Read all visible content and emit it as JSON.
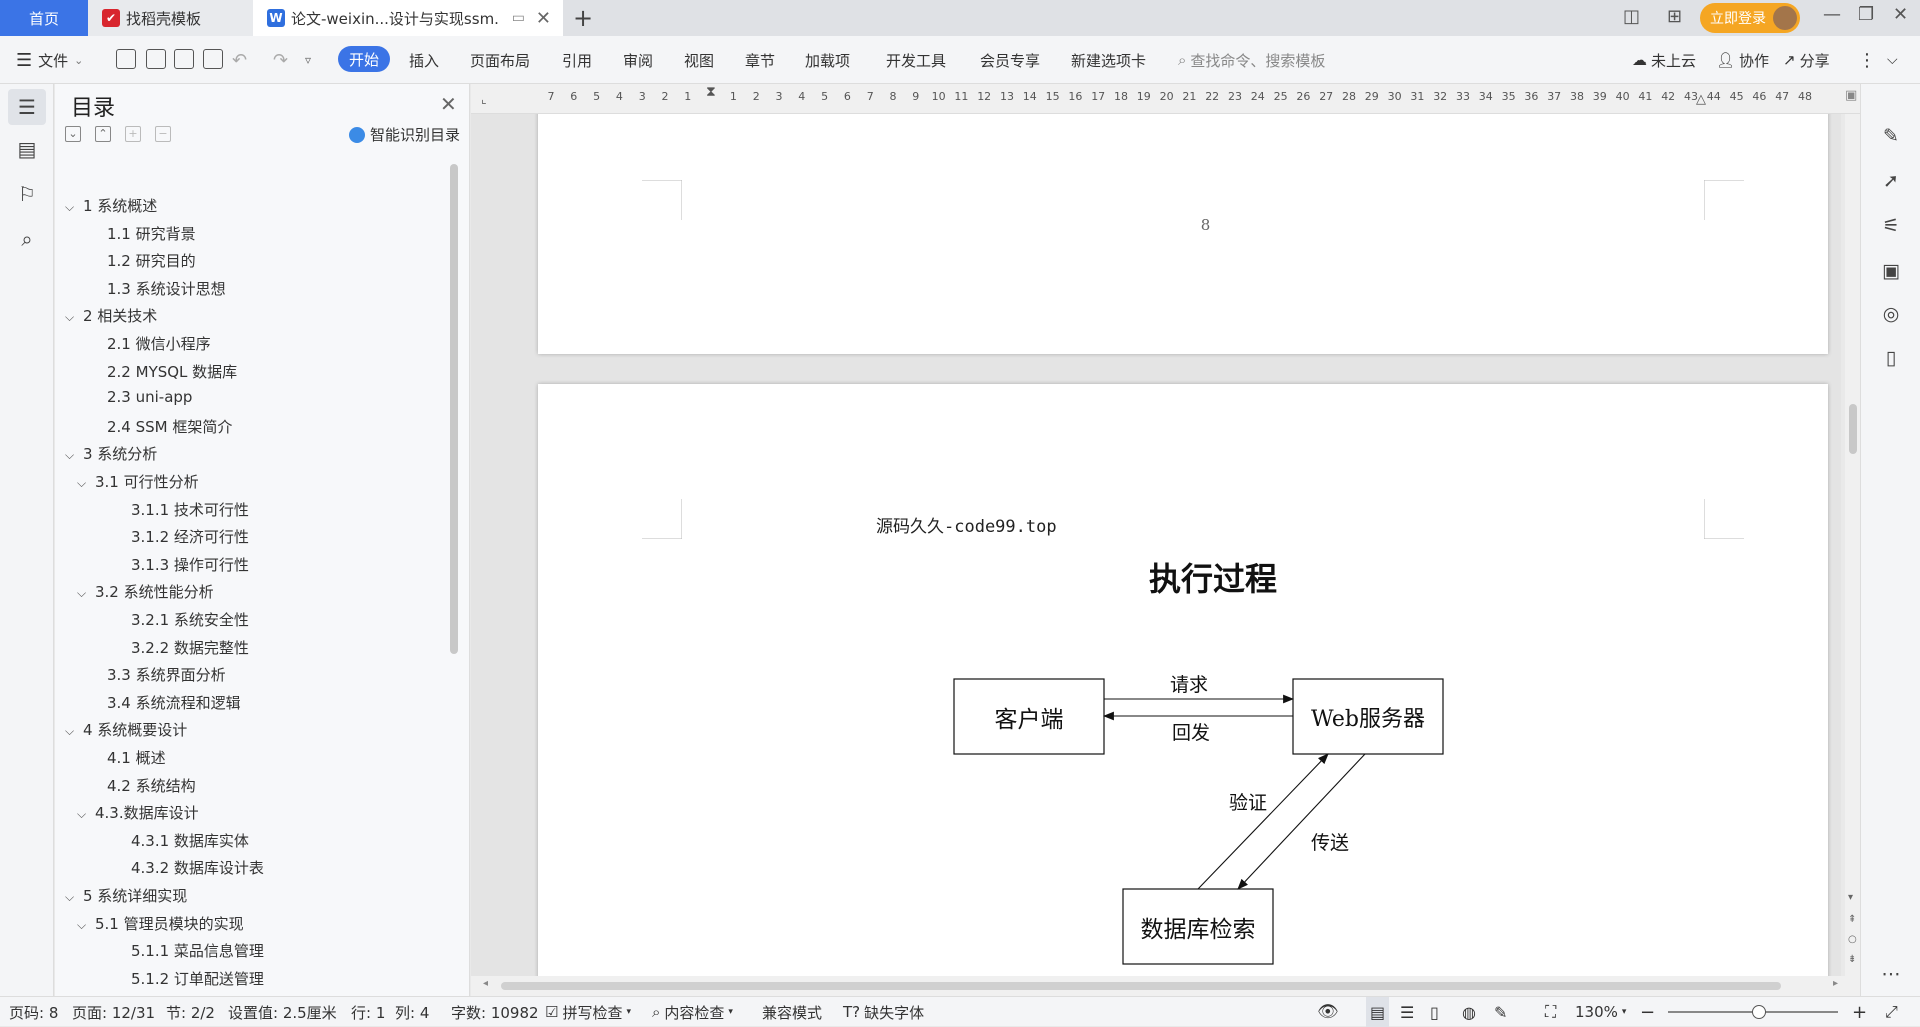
{
  "tabs": {
    "home": "首页",
    "template": "找稻壳模板",
    "document": "论文-weixin...设计与实现ssm."
  },
  "titlebar": {
    "login": "立即登录"
  },
  "toolbar": {
    "file": "文件",
    "tabs": [
      "开始",
      "插入",
      "页面布局",
      "引用",
      "审阅",
      "视图",
      "章节",
      "加载项",
      "开发工具",
      "会员专享",
      "新建选项卡"
    ],
    "search_placeholder": "查找命令、搜索模板",
    "cloud": "未上云",
    "collab": "协作",
    "share": "分享"
  },
  "toc": {
    "title": "目录",
    "smart": "智能识别目录",
    "items": [
      {
        "label": "1 系统概述",
        "level": 1,
        "arrow": true
      },
      {
        "label": "1.1  研究背景",
        "level": 2,
        "arrow": false
      },
      {
        "label": "1.2 研究目的",
        "level": 2,
        "arrow": false
      },
      {
        "label": "1.3 系统设计思想",
        "level": 2,
        "arrow": false
      },
      {
        "label": "2 相关技术",
        "level": 1,
        "arrow": true
      },
      {
        "label": "2.1 微信小程序",
        "level": 2,
        "arrow": false
      },
      {
        "label": "2.2 MYSQL 数据库",
        "level": 2,
        "arrow": false
      },
      {
        "label": "2.3 uni-app",
        "level": 2,
        "arrow": false
      },
      {
        "label": "2.4 SSM 框架简介",
        "level": 2,
        "arrow": false
      },
      {
        "label": "3 系统分析",
        "level": 1,
        "arrow": true
      },
      {
        "label": "3.1 可行性分析",
        "level": 2,
        "arrow": true
      },
      {
        "label": "3.1.1 技术可行性",
        "level": 3,
        "arrow": false
      },
      {
        "label": "3.1.2 经济可行性",
        "level": 3,
        "arrow": false
      },
      {
        "label": "3.1.3 操作可行性",
        "level": 3,
        "arrow": false
      },
      {
        "label": "3.2 系统性能分析",
        "level": 2,
        "arrow": true
      },
      {
        "label": "3.2.1  系统安全性",
        "level": 3,
        "arrow": false
      },
      {
        "label": "3.2.2  数据完整性",
        "level": 3,
        "arrow": false
      },
      {
        "label": "3.3 系统界面分析",
        "level": 2,
        "arrow": false
      },
      {
        "label": "3.4 系统流程和逻辑",
        "level": 2,
        "arrow": false
      },
      {
        "label": "4 系统概要设计",
        "level": 1,
        "arrow": true
      },
      {
        "label": "4.1 概述",
        "level": 2,
        "arrow": false
      },
      {
        "label": "4.2 系统结构",
        "level": 2,
        "arrow": false
      },
      {
        "label": "4.3.数据库设计",
        "level": 2,
        "arrow": true
      },
      {
        "label": "4.3.1 数据库实体",
        "level": 3,
        "arrow": false
      },
      {
        "label": "4.3.2 数据库设计表",
        "level": 3,
        "arrow": false
      },
      {
        "label": "5 系统详细实现",
        "level": 1,
        "arrow": true
      },
      {
        "label": "5.1  管理员模块的实现",
        "level": 2,
        "arrow": true
      },
      {
        "label": "5.1.1  菜品信息管理",
        "level": 3,
        "arrow": false
      },
      {
        "label": "5.1.2  订单配送管理",
        "level": 3,
        "arrow": false
      }
    ]
  },
  "ruler": {
    "ticks": [
      "7",
      "6",
      "5",
      "4",
      "3",
      "2",
      "1",
      "",
      "1",
      "2",
      "3",
      "4",
      "5",
      "6",
      "7",
      "8",
      "9",
      "10",
      "11",
      "12",
      "13",
      "14",
      "15",
      "16",
      "17",
      "18",
      "19",
      "20",
      "21",
      "22",
      "23",
      "24",
      "25",
      "26",
      "27",
      "28",
      "29",
      "30",
      "31",
      "32",
      "33",
      "34",
      "35",
      "36",
      "37",
      "38",
      "39",
      "40",
      "41",
      "42",
      "43",
      "44",
      "45",
      "46",
      "47",
      "48"
    ]
  },
  "document": {
    "page_number": "8",
    "header_text": "源码久久-code99.top",
    "diagram_title": "执行过程",
    "nodes": {
      "client": "客户端",
      "server": "Web服务器",
      "db": "数据库检索"
    },
    "edges": {
      "request": "请求",
      "reply": "回发",
      "verify": "验证",
      "send": "传送"
    }
  },
  "status": {
    "page_code": "页码: 8",
    "page": "页面: 12/31",
    "section": "节: 2/2",
    "setting": "设置值: 2.5厘米",
    "row": "行: 1",
    "col": "列: 4",
    "words": "字数: 10982",
    "spell": "拼写检查",
    "content_check": "内容检查",
    "compat": "兼容模式",
    "missing_font": "缺失字体",
    "zoom": "130%"
  }
}
